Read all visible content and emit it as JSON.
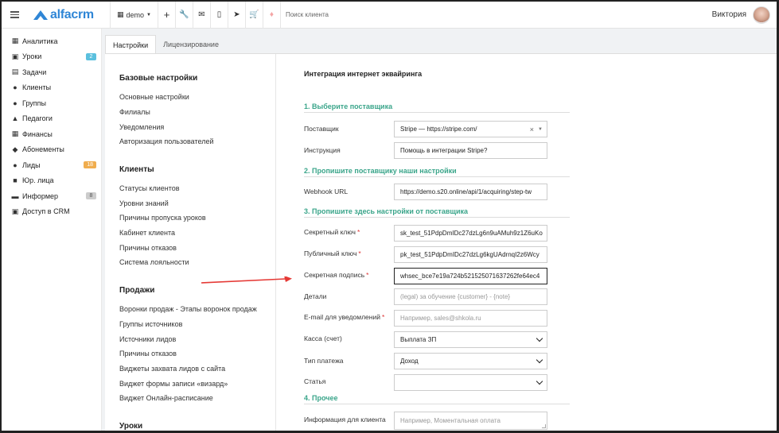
{
  "topbar": {
    "logo_text": "alfacrm",
    "demo_label": "demo",
    "search_placeholder": "Поиск клиента",
    "user_name": "Виктория",
    "icons": [
      "plus-icon",
      "wrench-icon",
      "envelope-icon",
      "phone-icon",
      "telegram-icon",
      "cart-icon",
      "bell-icon"
    ]
  },
  "sidebar": {
    "items": [
      {
        "label": "Аналитика",
        "icon": "chart-icon",
        "badge": null
      },
      {
        "label": "Уроки",
        "icon": "calendar-icon",
        "badge": "2",
        "badge_color": "#5bc0de"
      },
      {
        "label": "Задачи",
        "icon": "clipboard-icon",
        "badge": null
      },
      {
        "label": "Клиенты",
        "icon": "user-icon",
        "badge": null
      },
      {
        "label": "Группы",
        "icon": "users-icon",
        "badge": null
      },
      {
        "label": "Педагоги",
        "icon": "graduation-cap-icon",
        "badge": null
      },
      {
        "label": "Финансы",
        "icon": "money-icon",
        "badge": null
      },
      {
        "label": "Абонементы",
        "icon": "tag-icon",
        "badge": null
      },
      {
        "label": "Лиды",
        "icon": "user-plus-icon",
        "badge": "18",
        "badge_color": "#f0ad4e"
      },
      {
        "label": "Юр. лица",
        "icon": "briefcase-icon",
        "badge": null
      },
      {
        "label": "Информер",
        "icon": "inbox-icon",
        "badge": "8",
        "badge_color": "#cccccc"
      },
      {
        "label": "Доступ в CRM",
        "icon": "lock-icon",
        "badge": null
      }
    ]
  },
  "tabs": [
    {
      "label": "Настройки",
      "active": true
    },
    {
      "label": "Лицензирование",
      "active": false
    }
  ],
  "settings_menu": {
    "sections": [
      {
        "title": "Базовые настройки",
        "links": [
          "Основные настройки",
          "Филиалы",
          "Уведомления",
          "Авторизация пользователей"
        ]
      },
      {
        "title": "Клиенты",
        "links": [
          "Статусы клиентов",
          "Уровни знаний",
          "Причины пропуска уроков",
          "Кабинет клиента",
          "Причины отказов",
          "Система лояльности"
        ]
      },
      {
        "title": "Продажи",
        "links": [
          "Воронки продаж - Этапы воронок продаж",
          "Группы источников",
          "Источники лидов",
          "Причины отказов",
          "Виджеты захвата лидов с сайта",
          "Виджет формы записи «визард»",
          "Виджет Онлайн-расписание"
        ]
      },
      {
        "title": "Уроки",
        "links": []
      }
    ]
  },
  "form": {
    "title": "Интеграция интернет эквайринга",
    "step1": "1. Выберите поставщика",
    "step2": "2. Пропишите поставщику наши настройки",
    "step3": "3. Пропишите здесь настройки от поставщика",
    "step4": "4. Прочее",
    "provider_label": "Поставщик",
    "provider_value": "Stripe — https://stripe.com/",
    "instruction_label": "Инструкция",
    "instruction_value": "Помощь в интеграции Stripe?",
    "webhook_label": "Webhook URL",
    "webhook_value": "https://demo.s20.online/api/1/acquiring/step-tw",
    "secret_key_label": "Секретный ключ",
    "secret_key_value": "sk_test_51PdpDmIDc27dzLg6n9uAMuh9z1Z6uKo",
    "public_key_label": "Публичный ключ",
    "public_key_value": "pk_test_51PdpDmIDc27dzLg6kgUAdrnqI2z6Wcy",
    "signature_label": "Секретная подпись",
    "signature_value": "whsec_bce7e19a724b521525071637262fe64ec4",
    "details_label": "Детали",
    "details_placeholder": "(legal) за обучение {customer} - {note}",
    "email_label": "E-mail для уведомлений",
    "email_placeholder": "Например, sales@shkola.ru",
    "cashbox_label": "Касса (счет)",
    "cashbox_value": "Выплата ЗП",
    "payment_type_label": "Тип платежа",
    "payment_type_value": "Доход",
    "article_label": "Статья",
    "article_value": "",
    "client_info_label": "Информация для клиента",
    "client_info_placeholder": "Например, Моментальная оплата",
    "required_mark": "*",
    "accent_color": "#3aa58a",
    "arrow_color": "#e53935"
  }
}
